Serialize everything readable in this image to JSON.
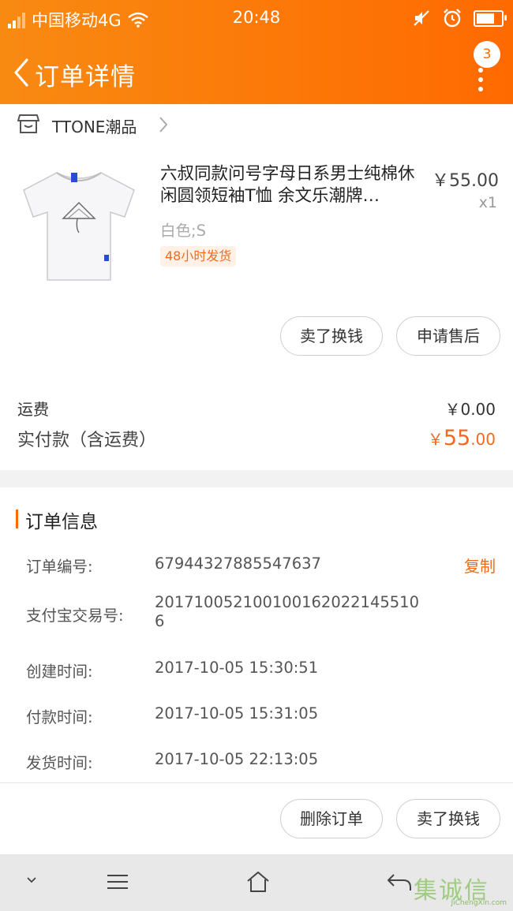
{
  "status_bar": {
    "carrier": "中国移动4G",
    "time": "20:48"
  },
  "header": {
    "title": "订单详情",
    "badge": "3"
  },
  "shop": {
    "name": "TTONE潮品"
  },
  "product": {
    "title": "六叔同款问号字母日系男士纯棉休闲圆领短袖T恤 余文乐潮牌…",
    "price": "￥55.00",
    "qty": "x1",
    "sku": "白色;S",
    "ship_tag": "48小时发货"
  },
  "item_actions": {
    "sell_label": "卖了换钱",
    "aftersale_label": "申请售后"
  },
  "summary": {
    "freight_label": "运费",
    "freight_value": "￥0.00",
    "paid_label": "实付款（含运费）",
    "paid_currency": "￥",
    "paid_int": "55",
    "paid_dec": ".00"
  },
  "order_info": {
    "title": "订单信息",
    "copy_label": "复制",
    "rows": [
      {
        "label": "订单编号:",
        "value": "67944327885547637"
      },
      {
        "label": "支付宝交易号:",
        "value": "2017100521001001620221455106"
      },
      {
        "label": "创建时间:",
        "value": "2017-10-05 15:30:51"
      },
      {
        "label": "付款时间:",
        "value": "2017-10-05 15:31:05"
      },
      {
        "label": "发货时间:",
        "value": "2017-10-05 22:13:05"
      }
    ]
  },
  "bottom_actions": {
    "delete_label": "删除订单",
    "sell_label": "卖了换钱"
  },
  "watermark": {
    "text": "集诚信",
    "sub": "JiChengXin.com"
  },
  "colors": {
    "accent": "#ff6a00",
    "price_orange": "#f36a1c"
  }
}
